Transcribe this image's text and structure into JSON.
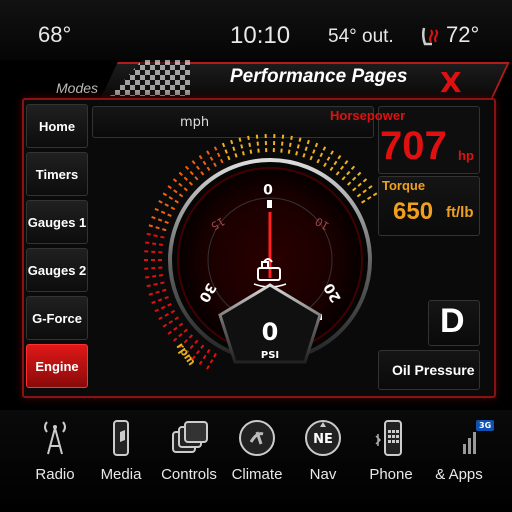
{
  "status": {
    "left_temp": "68°",
    "time": "10:10",
    "outside_temp": "54° out.",
    "right_temp": "72°"
  },
  "header": {
    "title": "Performance Pages",
    "modes_label": "Modes",
    "close_label": "X"
  },
  "sidebar": {
    "items": [
      {
        "label": "Home"
      },
      {
        "label": "Timers"
      },
      {
        "label": "Gauges 1"
      },
      {
        "label": "Gauges 2"
      },
      {
        "label": "G-Force"
      },
      {
        "label": "Engine",
        "active": true
      }
    ]
  },
  "gauge": {
    "speed_unit": "mph",
    "rpm_label": "rpm",
    "ticks": [
      "0",
      "10",
      "20",
      "30",
      "15"
    ],
    "value": "0",
    "unit": "PSI",
    "icon": "oil-pressure-icon"
  },
  "stats": {
    "horsepower_label": "Horsepower",
    "horsepower_value": "707",
    "horsepower_unit": "hp",
    "torque_label": "Torque",
    "torque_value": "650",
    "torque_unit": "ft/lb",
    "gear": "D",
    "oil_pressure_label": "Oil Pressure"
  },
  "bottom_nav": {
    "items": [
      {
        "label": "Radio",
        "icon": "radio-tower-icon"
      },
      {
        "label": "Media",
        "icon": "media-phone-icon"
      },
      {
        "label": "Controls",
        "icon": "controls-icon"
      },
      {
        "label": "Climate",
        "icon": "climate-icon"
      },
      {
        "label": "Nav",
        "icon": "compass-icon"
      },
      {
        "label": "Phone",
        "icon": "phone-icon"
      },
      {
        "label": "& Apps",
        "icon": "apps-icon"
      }
    ],
    "badge": "3G"
  },
  "colors": {
    "accent": "#e01010",
    "gold": "#f0a020",
    "panel_border": "#8a1212"
  }
}
